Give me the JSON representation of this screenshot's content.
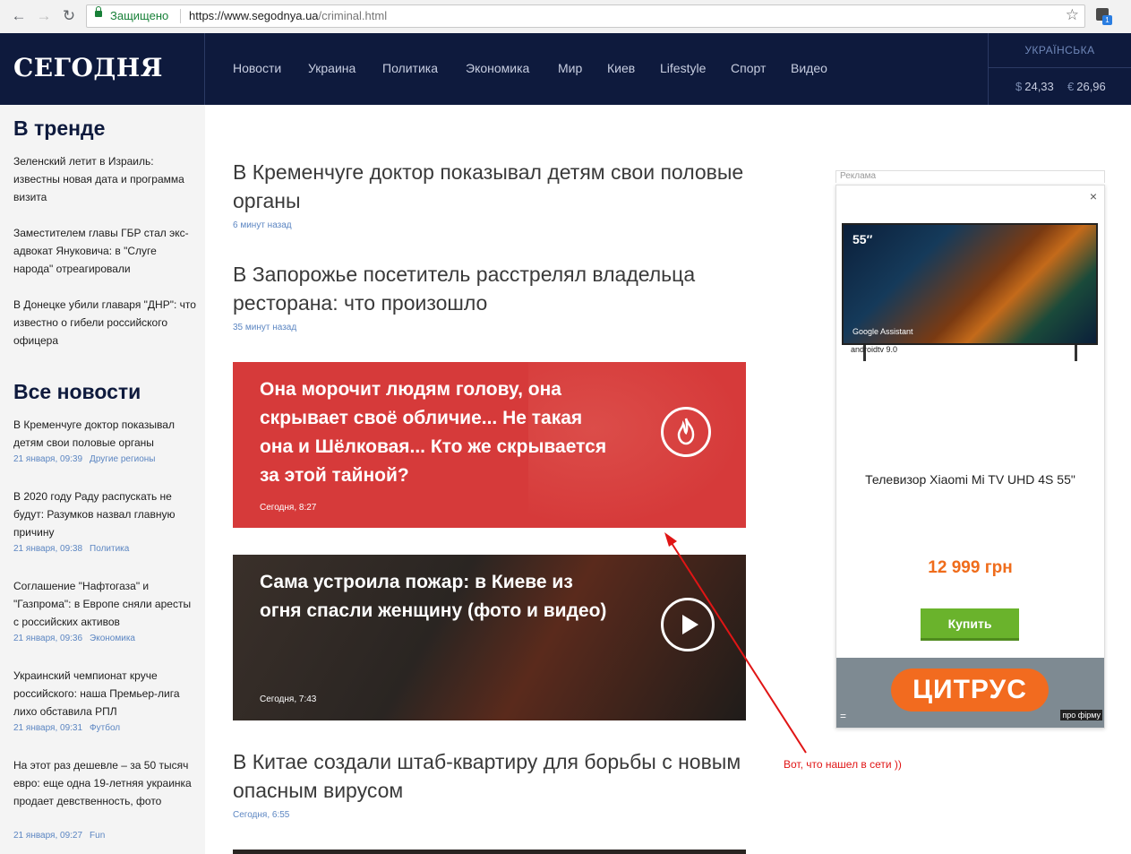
{
  "browser": {
    "secure_label": "Защищено",
    "url_host": "https://www.segodnya.ua",
    "url_path": "/criminal.html",
    "ext_badge": "1"
  },
  "header": {
    "logo": "СЕГОДНЯ",
    "nav": [
      "Новости",
      "Украина",
      "Политика",
      "Экономика",
      "Мир",
      "Киев",
      "Lifestyle",
      "Спорт",
      "Видео"
    ],
    "lang": "УКРАЇНСЬКА",
    "usd_symbol": "$",
    "usd": "24,33",
    "eur_symbol": "€",
    "eur": "26,96"
  },
  "sidebar": {
    "trend_title": "В тренде",
    "trend": [
      "Зеленский летит в Израиль: известны новая дата и программа визита",
      "Заместителем главы ГБР стал экс-адвокат Януковича: в \"Слуге народа\" отреагировали",
      "В Донецке убили главаря \"ДНР\": что известно о гибели российского офицера"
    ],
    "all_title": "Все новости",
    "all": [
      {
        "text": "В Кременчуге доктор показывал детям свои половые органы",
        "time": "21 января, 09:39",
        "cat": "Другие регионы"
      },
      {
        "text": "В 2020 году Раду распускать не будут: Разумков назвал главную причину",
        "time": "21 января, 09:38",
        "cat": "Политика"
      },
      {
        "text": "Соглашение \"Нафтогаза\" и \"Газпрома\": в Европе сняли аресты с российских активов",
        "time": "21 января, 09:36",
        "cat": "Экономика"
      },
      {
        "text": "Украинский чемпионат круче российского: наша Премьер-лига лихо обставила РПЛ",
        "time": "21 января, 09:31",
        "cat": "Футбол"
      },
      {
        "text": "На этот раз дешевле – за 50 тысяч евро: еще одна 19-летняя украинка продает девственность, фото",
        "time": "21 января, 09:27",
        "cat": "Fun"
      }
    ]
  },
  "main": {
    "articles": [
      {
        "title": "В Кременчуге доктор показывал детям свои половые органы",
        "time": "6 минут назад"
      },
      {
        "title": "В Запорожье посетитель расстрелял владельца ресторана: что произошло",
        "time": "35 минут назад"
      }
    ],
    "card_hot": {
      "title": "Она морочит людям голову, она скрывает своё обличие... Не такая она и Шёлковая... Кто же скрывается за этой тайной?",
      "time": "Сегодня, 8:27",
      "icon": "fire-icon"
    },
    "card_video": {
      "title": "Сама устроила пожар: в Киеве из огня спасли женщину (фото и видео)",
      "time": "Сегодня, 7:43",
      "icon": "play-icon"
    },
    "article3": {
      "title": "В Китае создали штаб-квартиру для борьбы с новым опасным вирусом",
      "time": "Сегодня, 6:55"
    }
  },
  "ad": {
    "label": "Реклама",
    "close": "×",
    "tv_size": "55″",
    "tv_assistant": "Google Assistant",
    "tv_os": "androidtv 9.0",
    "title": "Телевизор Xiaomi Mi TV UHD 4S 55\"",
    "price": "12 999 грн",
    "buy": "Купить",
    "brand": "ЦИТРУС",
    "firm": "про фірму",
    "menu": "="
  },
  "annotation": "Вот, что нашел в сети ))",
  "colors": {
    "header_bg": "#0e1a3d",
    "accent_blue": "#5c86c2",
    "hot_red": "#d63a3a",
    "price_orange": "#ef6c1b",
    "buy_green": "#6ab32c",
    "arrow_red": "#e01515"
  }
}
